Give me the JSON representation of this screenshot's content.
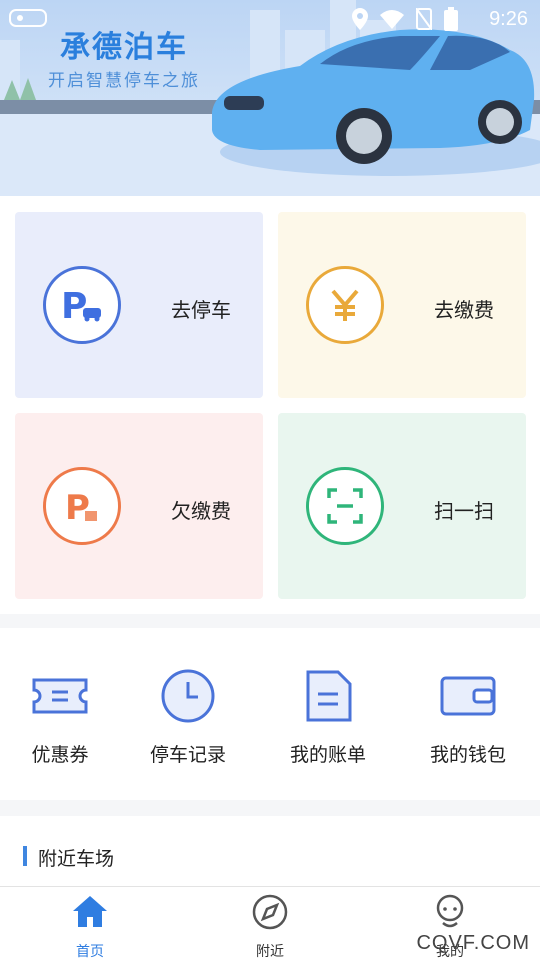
{
  "status_bar": {
    "time": "9:26"
  },
  "banner": {
    "title": "承德泊车",
    "subtitle": "开启智慧停车之旅"
  },
  "cards": [
    {
      "label": "去停车",
      "icon": "parking-car-icon",
      "color": "#3f6fe0"
    },
    {
      "label": "去缴费",
      "icon": "yen-icon",
      "color": "#e9a93a"
    },
    {
      "label": "欠缴费",
      "icon": "parking-owed-icon",
      "color": "#ee7a4a"
    },
    {
      "label": "扫一扫",
      "icon": "scan-icon",
      "color": "#2fb57a"
    }
  ],
  "quick_menu": [
    {
      "label": "优惠券",
      "icon": "coupon-icon"
    },
    {
      "label": "停车记录",
      "icon": "clock-icon"
    },
    {
      "label": "我的账单",
      "icon": "bill-icon"
    },
    {
      "label": "我的钱包",
      "icon": "wallet-icon"
    }
  ],
  "nearby": {
    "heading": "附近车场"
  },
  "tabbar": [
    {
      "label": "首页",
      "icon": "home-icon",
      "active": true
    },
    {
      "label": "附近",
      "icon": "compass-icon",
      "active": false
    },
    {
      "label": "我的",
      "icon": "user-icon",
      "active": false
    }
  ],
  "watermark": "CQVF.COM",
  "colors": {
    "accent": "#2f7de1",
    "icon_blue": "#4a73d9"
  }
}
